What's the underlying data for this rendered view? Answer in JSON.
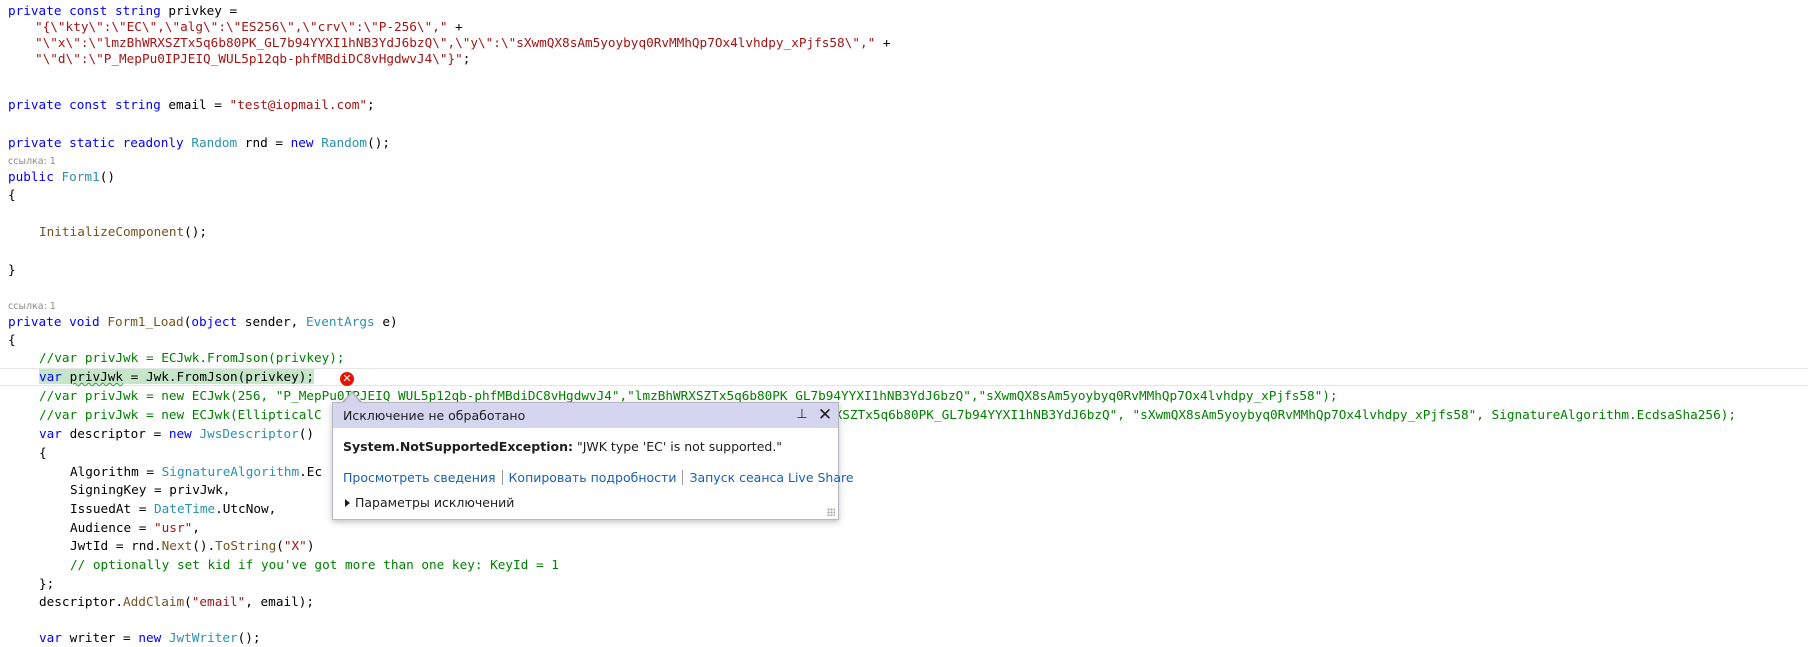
{
  "editor": {
    "codelens_ref1": "ссылка: 1",
    "codelens_ref2": "ссылка: 1",
    "lines": {
      "l1": {
        "a": "private const string ",
        "b": "privkey ="
      },
      "l2": {
        "a": "\"{\\\"kty\\\":\\\"EC\\\",\\\"alg\\\":\\\"ES256\\\",\\\"crv\\\":\\\"P-256\\\",\"",
        "b": " +"
      },
      "l3": {
        "a": "\"\\\"x\\\":\\\"lmzBhWRXSZTx5q6b80PK_GL7b94YYXI1hNB3YdJ6bzQ\\\",\\\"y\\\":\\\"sXwmQX8sAm5yoybyq0RvMMhQp7Ox4lvhdpy_xPjfs58\\\",\"",
        "b": " +"
      },
      "l4": {
        "a": "\"\\\"d\\\":\\\"P_MepPu0IPJEIQ_WUL5p12qb-phfMBdiDC8vHgdwvJ4\\\"}\"",
        "b": ";"
      },
      "l5": {
        "a": "private const string ",
        "b": "email = ",
        "c": "\"test@iopmail.com\"",
        "d": ";"
      },
      "l6": {
        "a": "private static readonly ",
        "b": "Random",
        "c": " rnd = ",
        "d": "new ",
        "e": "Random",
        "f": "();"
      },
      "l7": {
        "a": "public ",
        "b": "Form1",
        "c": "()"
      },
      "l8": {
        "a": "{"
      },
      "l9": {
        "a": "InitializeComponent",
        "b": "();"
      },
      "l10": {
        "a": "}"
      },
      "l11": {
        "a": "private void ",
        "b": "Form1_Load",
        "c": "(",
        "d": "object ",
        "e": "sender, ",
        "f": "EventArgs",
        "g": " e)"
      },
      "l12": {
        "a": "{"
      },
      "l13": {
        "a": "//var privJwk = ECJwk.FromJson(privkey);"
      },
      "l14": {
        "a": "var ",
        "b": "privJwk",
        "c": " = Jwk.FromJson(privkey);"
      },
      "l15": {
        "a": "//var privJwk = new ECJwk(256, \"P_MepPu0IPJEIQ_WUL5p12qb-phfMBdiDC8vHgdwvJ4\",\"lmzBhWRXSZTx5q6b80PK_GL7b94YYXI1hNB3YdJ6bzQ\",\"sXwmQX8sAm5yoybyq0RvMMhQp7Ox4lvhdpy_xPjfs58\");"
      },
      "l16": {
        "a": "//var privJwk = new ECJwk(EllipticalC",
        "b": "RXSZTx5q6b80PK_GL7b94YYXI1hNB3YdJ6bzQ\", \"sXwmQX8sAm5yoybyq0RvMMhQp7Ox4lvhdpy_xPjfs58\", SignatureAlgorithm.EcdsaSha256);"
      },
      "l17": {
        "a": "var ",
        "b": "descriptor = ",
        "c": "new ",
        "d": "JwsDescriptor",
        "e": "()"
      },
      "l18": {
        "a": "{"
      },
      "l19": {
        "a": "Algorithm = ",
        "b": "SignatureAlgorithm",
        "c": ".Ec"
      },
      "l20": {
        "a": "SigningKey = privJwk,"
      },
      "l21": {
        "a": "IssuedAt = ",
        "b": "DateTime",
        "c": ".UtcNow,"
      },
      "l22": {
        "a": "Audience = ",
        "b": "\"usr\"",
        "c": ","
      },
      "l23": {
        "a": "JwtId = rnd.",
        "b": "Next",
        "c": "().",
        "d": "ToString",
        "e": "(",
        "f": "\"X\"",
        "g": ")"
      },
      "l24": {
        "a": "// optionally set kid if you've got more than one key: KeyId = 1"
      },
      "l25": {
        "a": "};"
      },
      "l26": {
        "a": "descriptor.",
        "b": "AddClaim",
        "c": "(",
        "d": "\"email\"",
        "e": ", email);"
      },
      "l27": {
        "a": "var ",
        "b": "writer = ",
        "c": "new ",
        "d": "JwtWriter",
        "e": "();"
      }
    }
  },
  "error_glyph": "✕",
  "exception_popup": {
    "title": "Исключение не обработано",
    "exception_type": "System.NotSupportedException:",
    "exception_message": " \"JWK type 'EC' is not supported.\"",
    "link_view_details": "Просмотреть сведения",
    "link_copy_details": "Копировать подробности",
    "link_live_share": "Запуск сеанса Live Share",
    "exception_settings": "Параметры исключений",
    "pin_icon": "⊥",
    "close_icon": "✕"
  },
  "colors": {
    "keyword": "#0000ff",
    "type": "#2b91af",
    "string": "#a31515",
    "comment": "#008000",
    "method": "#74531f",
    "popup_header": "#d5d5f0",
    "link": "#1a5fb4",
    "error": "#e51400"
  }
}
